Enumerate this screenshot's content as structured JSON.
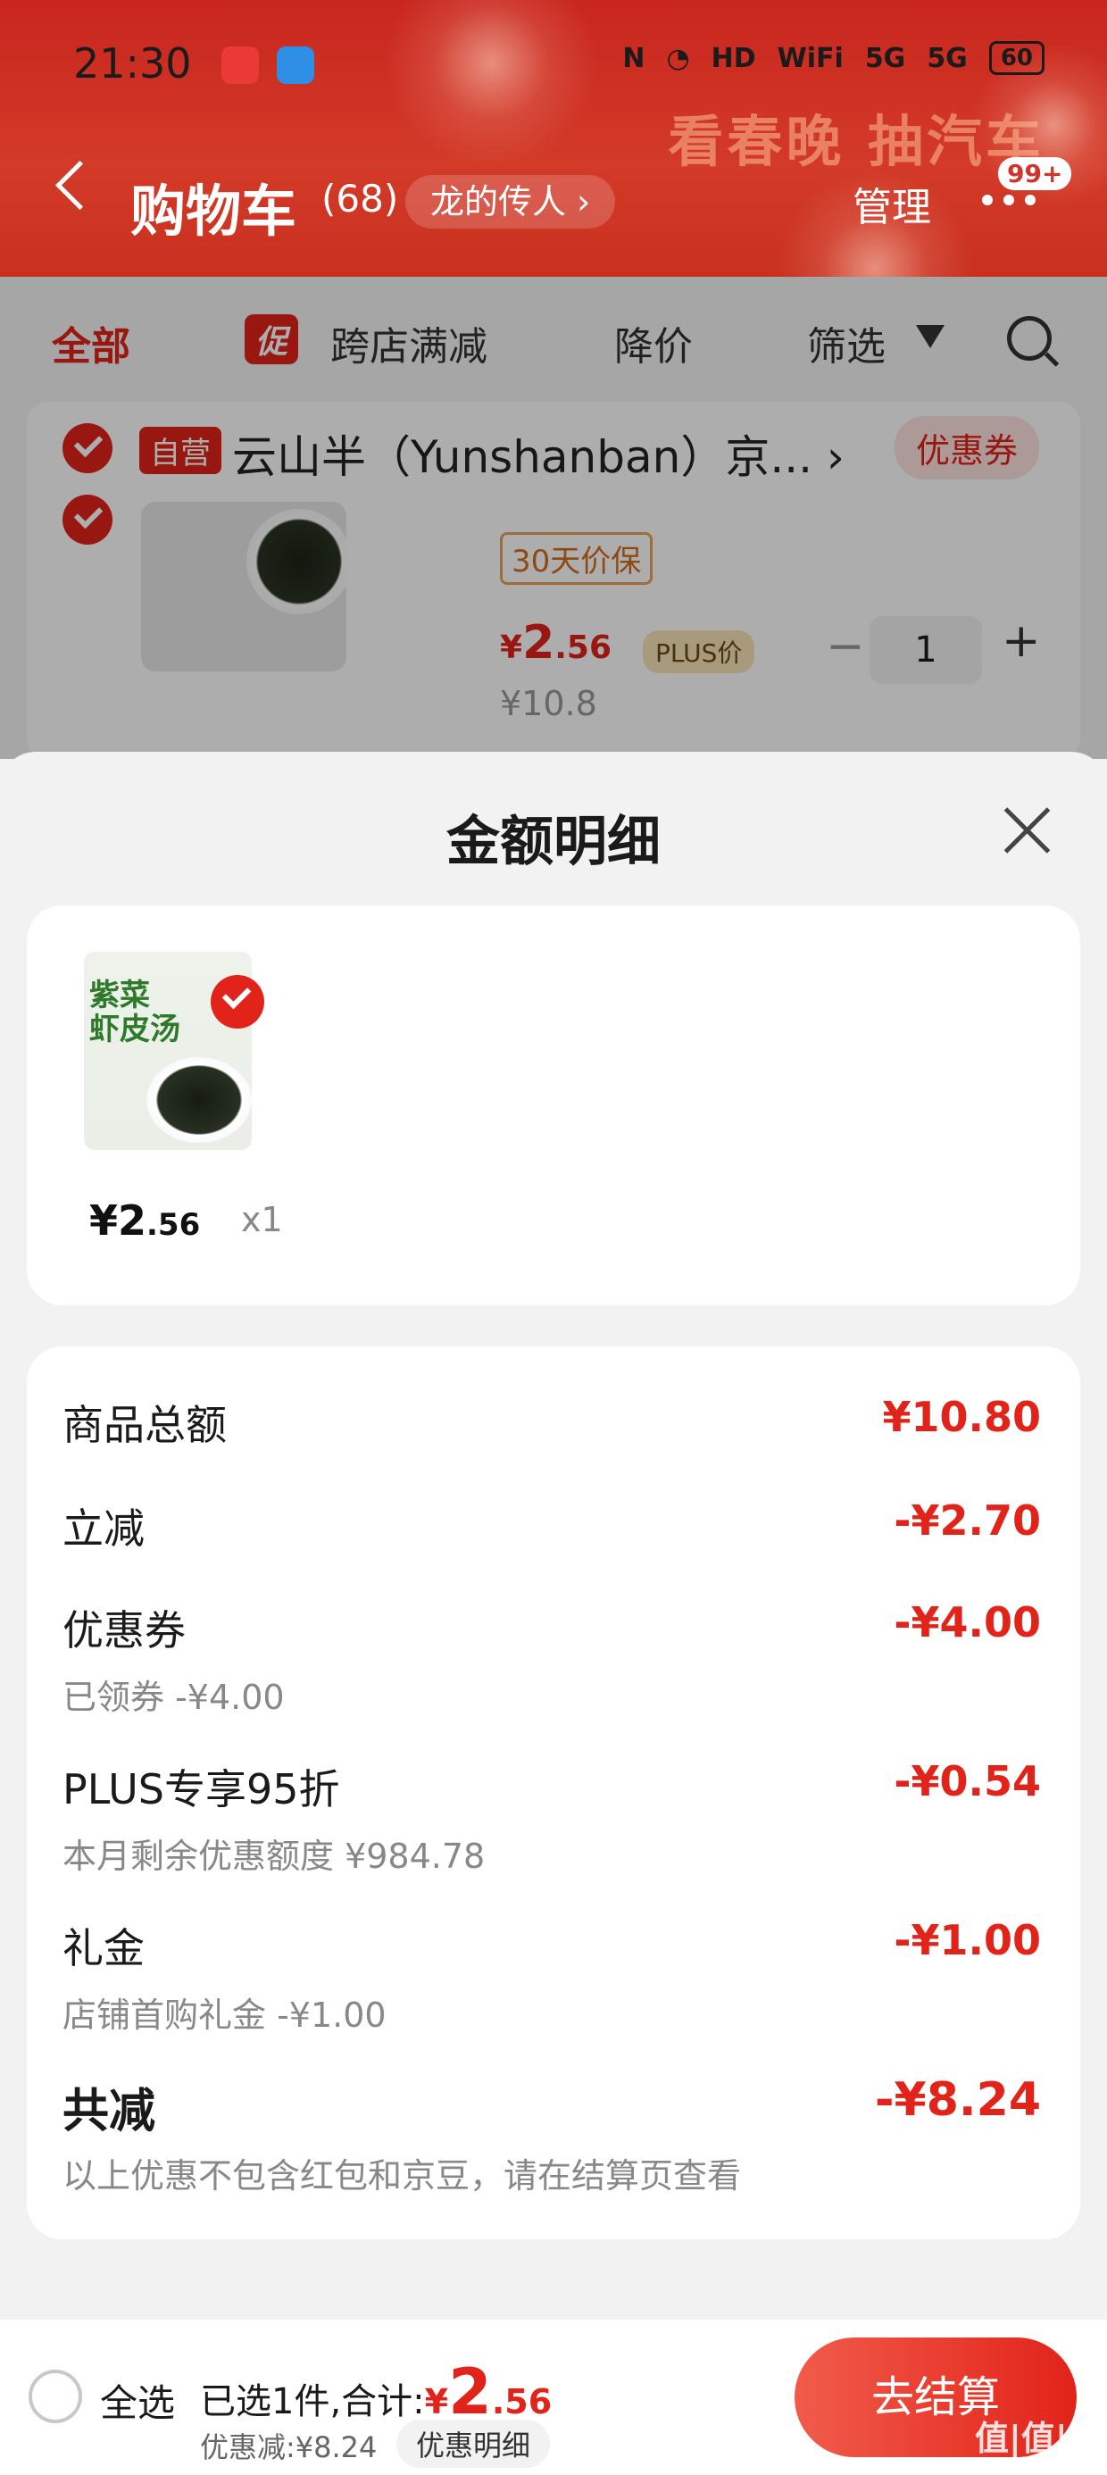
{
  "status_bar": {
    "time": "21:30",
    "icons_right": [
      "N",
      "◔",
      "HD",
      "WiFi",
      "5G",
      "5G"
    ],
    "battery": "60"
  },
  "header": {
    "back_icon": "chevron-left-icon",
    "title": "购物车",
    "count": "(68)",
    "location_pill": "龙的传人 ›",
    "manage": "管理",
    "badge": "99+",
    "promo_text": "看春晚 抽汽车"
  },
  "tabs": {
    "all": "全部",
    "promo_badge": "促",
    "cross_store": "跨店满减",
    "price_drop": "降价",
    "filter": "筛选"
  },
  "cart_item": {
    "self_operated": "自营",
    "shop_name": "云山半（Yunshanban）京... ›",
    "coupon": "优惠券",
    "price_guarantee": "30天价保",
    "price_symbol": "¥",
    "price_int": "2",
    "price_dec": ".56",
    "plus_tag": "PLUS价",
    "old_price": "¥10.8",
    "minus": "−",
    "quantity": "1",
    "plus": "+"
  },
  "sheet": {
    "title": "金额明细",
    "item": {
      "thumb_label": "紫菜\n虾皮汤",
      "price_prefix": "¥2",
      "price_dec": ".56",
      "qty": "x1"
    },
    "rows": [
      {
        "label": "商品总额",
        "value": "¥10.80",
        "sub": ""
      },
      {
        "label": "立减",
        "value": "-¥2.70",
        "sub": ""
      },
      {
        "label": "优惠券",
        "value": "-¥4.00",
        "sub": "已领券 -¥4.00"
      },
      {
        "label": "PLUS专享95折",
        "value": "-¥0.54",
        "sub": "本月剩余优惠额度 ¥984.78"
      },
      {
        "label": "礼金",
        "value": "-¥1.00",
        "sub": "店铺首购礼金 -¥1.00"
      }
    ],
    "total": {
      "label": "共减",
      "value": "-¥8.24",
      "note": "以上优惠不包含红包和京豆，请在结算页查看"
    }
  },
  "bottom_bar": {
    "select_all": "全选",
    "summary_prefix": "已选1件,合计:",
    "price_symbol": "¥",
    "price_int": "2",
    "price_dec": ".56",
    "discount": "优惠减:¥8.24",
    "detail_pill": "优惠明细",
    "checkout": "去结算"
  },
  "watermark": "值|值|值",
  "colors": {
    "brand_red": "#e2231a",
    "header_red": "#c8261e"
  }
}
